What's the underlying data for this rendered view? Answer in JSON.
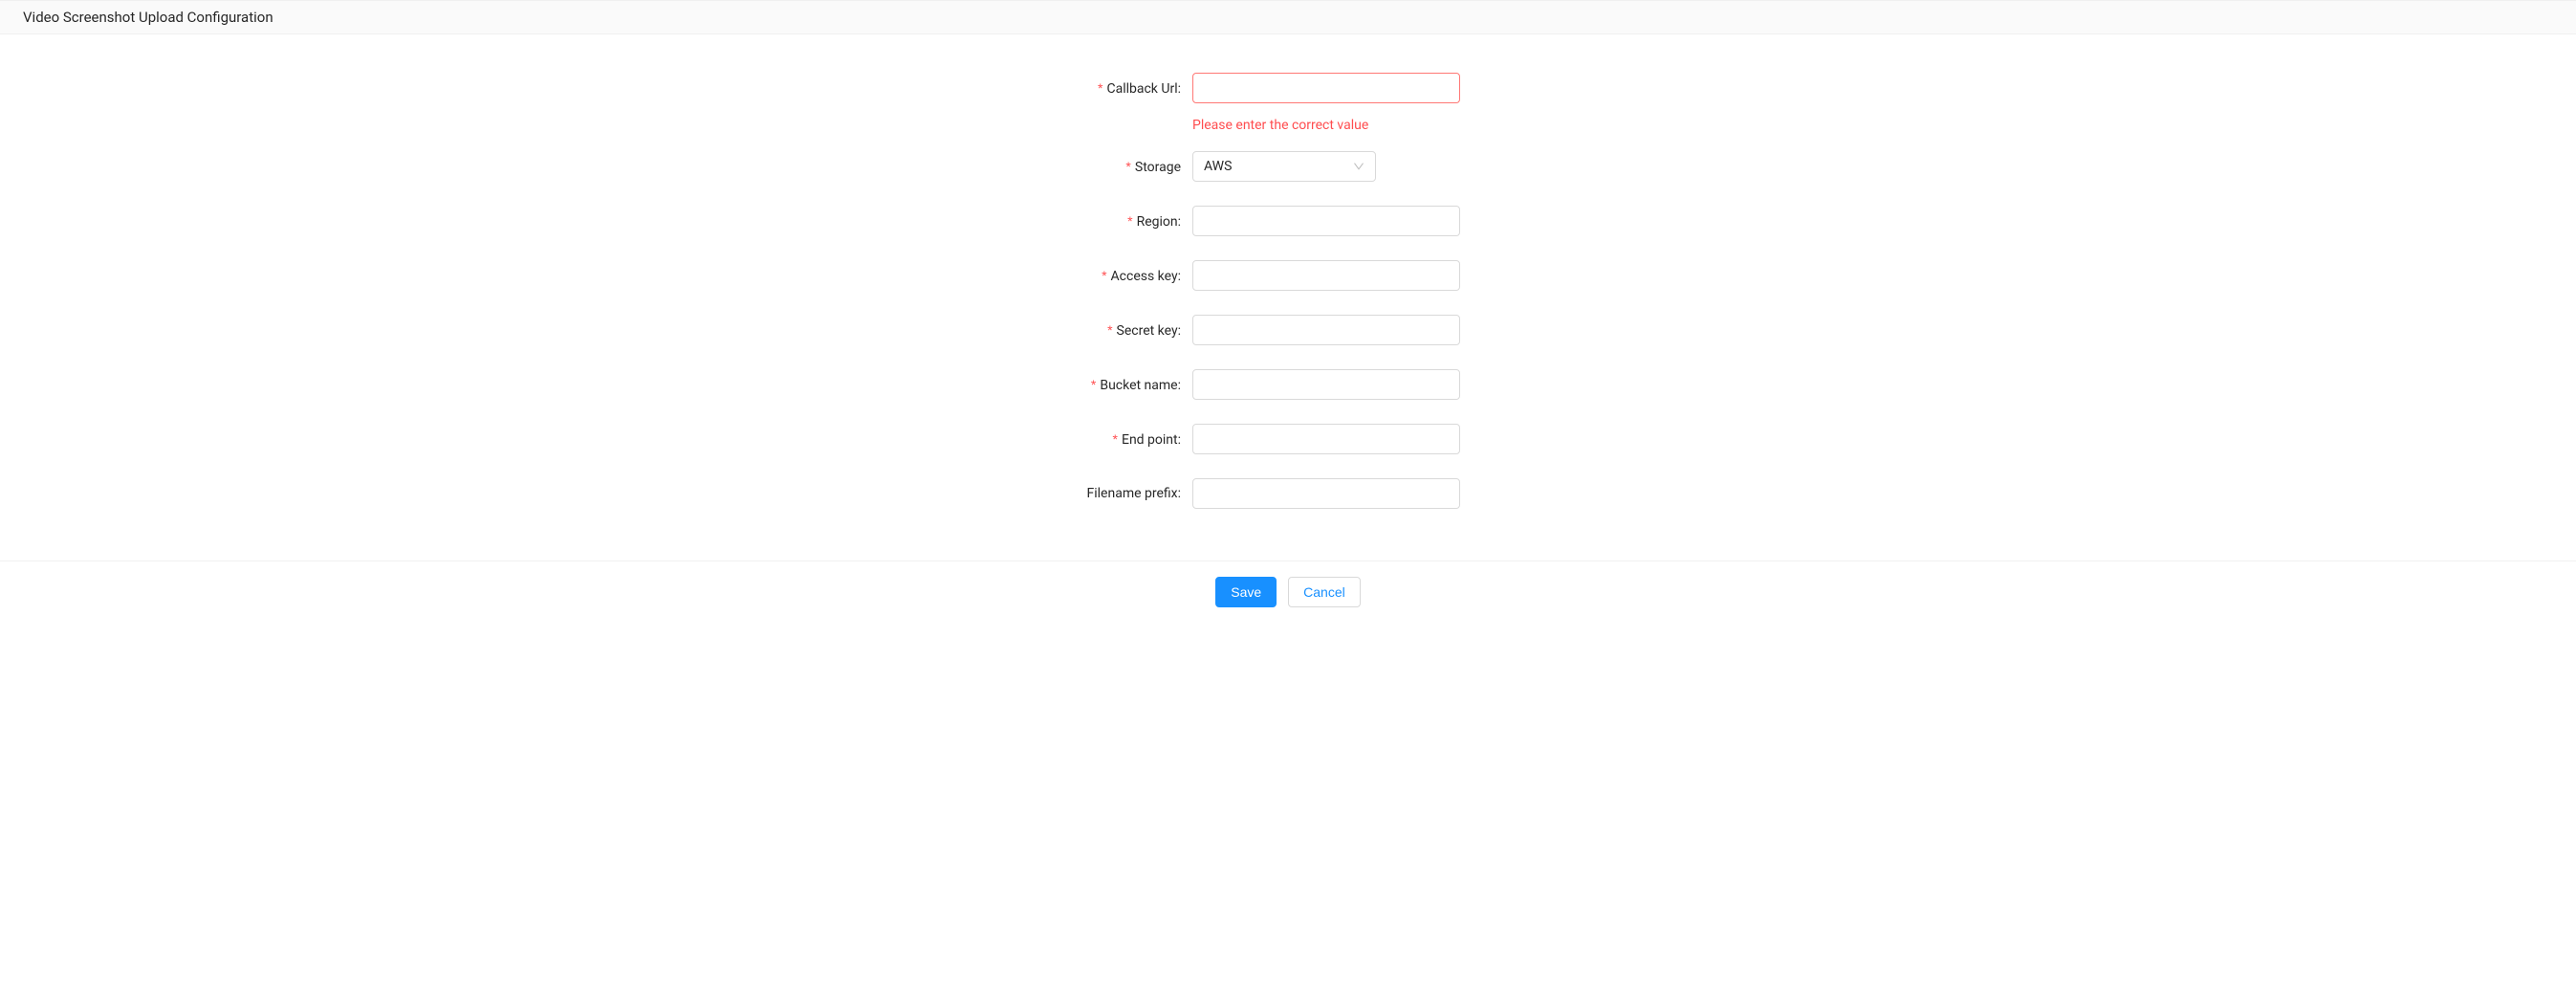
{
  "header": {
    "title": "Video Screenshot Upload Configuration"
  },
  "form": {
    "callback_url": {
      "label": "Callback Url:",
      "value": "",
      "error": "Please enter the correct value"
    },
    "storage": {
      "label": "Storage",
      "value": "AWS"
    },
    "region": {
      "label": "Region:",
      "value": ""
    },
    "access_key": {
      "label": "Access key:",
      "value": ""
    },
    "secret_key": {
      "label": "Secret key:",
      "value": ""
    },
    "bucket_name": {
      "label": "Bucket name:",
      "value": ""
    },
    "end_point": {
      "label": "End point:",
      "value": ""
    },
    "filename_prefix": {
      "label": "Filename prefix:",
      "value": ""
    }
  },
  "footer": {
    "save_label": "Save",
    "cancel_label": "Cancel"
  }
}
